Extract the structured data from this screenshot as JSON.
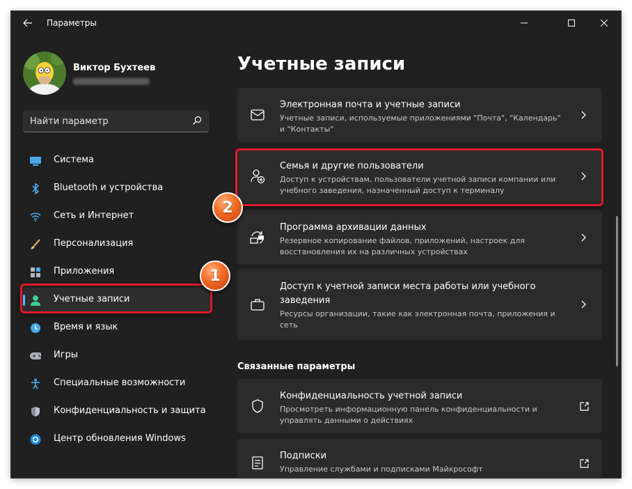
{
  "window": {
    "back_icon": "back-arrow-icon",
    "title": "Параметры",
    "controls": [
      "minimize-icon",
      "maximize-icon",
      "close-icon"
    ]
  },
  "user": {
    "name": "Виктор Бухтеев"
  },
  "search": {
    "placeholder": "Найти параметр",
    "icon": "search-icon"
  },
  "nav": {
    "items": [
      {
        "label": "Система",
        "icon": "system-icon"
      },
      {
        "label": "Bluetooth и устройства",
        "icon": "bluetooth-icon"
      },
      {
        "label": "Сеть и Интернет",
        "icon": "wifi-icon"
      },
      {
        "label": "Персонализация",
        "icon": "brush-icon"
      },
      {
        "label": "Приложения",
        "icon": "apps-icon"
      },
      {
        "label": "Учетные записи",
        "icon": "accounts-icon",
        "active": true
      },
      {
        "label": "Время и язык",
        "icon": "clock-globe-icon"
      },
      {
        "label": "Игры",
        "icon": "gamepad-icon"
      },
      {
        "label": "Специальные возможности",
        "icon": "accessibility-icon"
      },
      {
        "label": "Конфиденциальность и защита",
        "icon": "shield-icon"
      },
      {
        "label": "Центр обновления Windows",
        "icon": "update-icon"
      }
    ]
  },
  "main": {
    "title": "Учетные записи",
    "cards": [
      {
        "title": "Электронная почта и учетные записи",
        "desc": "Учетные записи, используемые приложениями \"Почта\", \"Календарь\" и \"Контакты\"",
        "icon": "mail-icon"
      },
      {
        "title": "Семья и другие пользователи",
        "desc": "Доступ к устройствам, пользователи учетной записи компании или учебного заведения, назначенный доступ к терминалу",
        "icon": "add-person-icon"
      },
      {
        "title": "Программа архивации данных",
        "desc": "Резервное копирование файлов, приложений, настроек для восстановления их на различных устройствах",
        "icon": "backup-icon"
      },
      {
        "title": "Доступ к учетной записи места работы или учебного заведения",
        "desc": "Ресурсы организации, такие как электронная почта, приложения и сеть",
        "icon": "briefcase-icon"
      }
    ],
    "related_title": "Связанные параметры",
    "related": [
      {
        "title": "Конфиденциальность учетной записи",
        "desc": "Просмотреть информационную панель конфиденциальности и управлять данными о действиях",
        "icon": "shield-outline-icon"
      },
      {
        "title": "Подписки",
        "desc": "Управление службами и подписками Майкрософт",
        "icon": "subscriptions-icon"
      }
    ]
  },
  "annotations": {
    "badge_1": "1",
    "badge_2": "2",
    "highlight_color": "#e3192b",
    "badge_color": "#f26a24"
  },
  "colors": {
    "background": "#202020",
    "card": "#2b2b2b",
    "accent": "#4cc2ff"
  }
}
